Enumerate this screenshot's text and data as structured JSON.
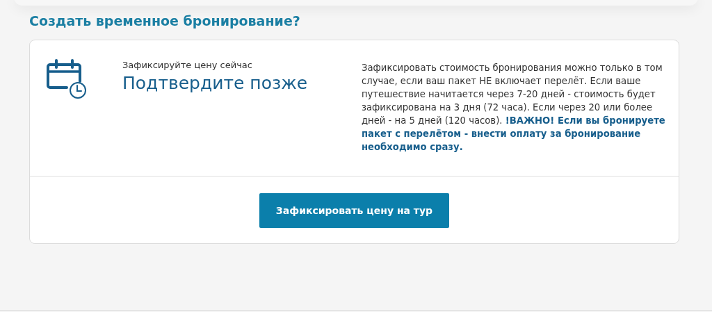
{
  "heading": "Создать временное бронирование?",
  "offer": {
    "kicker": "Зафиксируйте цену сейчас",
    "title": "Подтвердите позже",
    "description": "Зафиксировать стоимость бронирования можно только в том случае, если ваш пакет НЕ включает перелёт. Если ваше путешествие начитается через 7-20 дней - стоимость будет зафиксирована на 3 дня (72 часа). Если через 20 или более дней - на 5 дней (120 часов). **!ВАЖНО! Если вы бронируете пакет с перелётом - внести оплату за бронирование необходимо сразу.**"
  },
  "button": "Зафиксировать цену на тур"
}
